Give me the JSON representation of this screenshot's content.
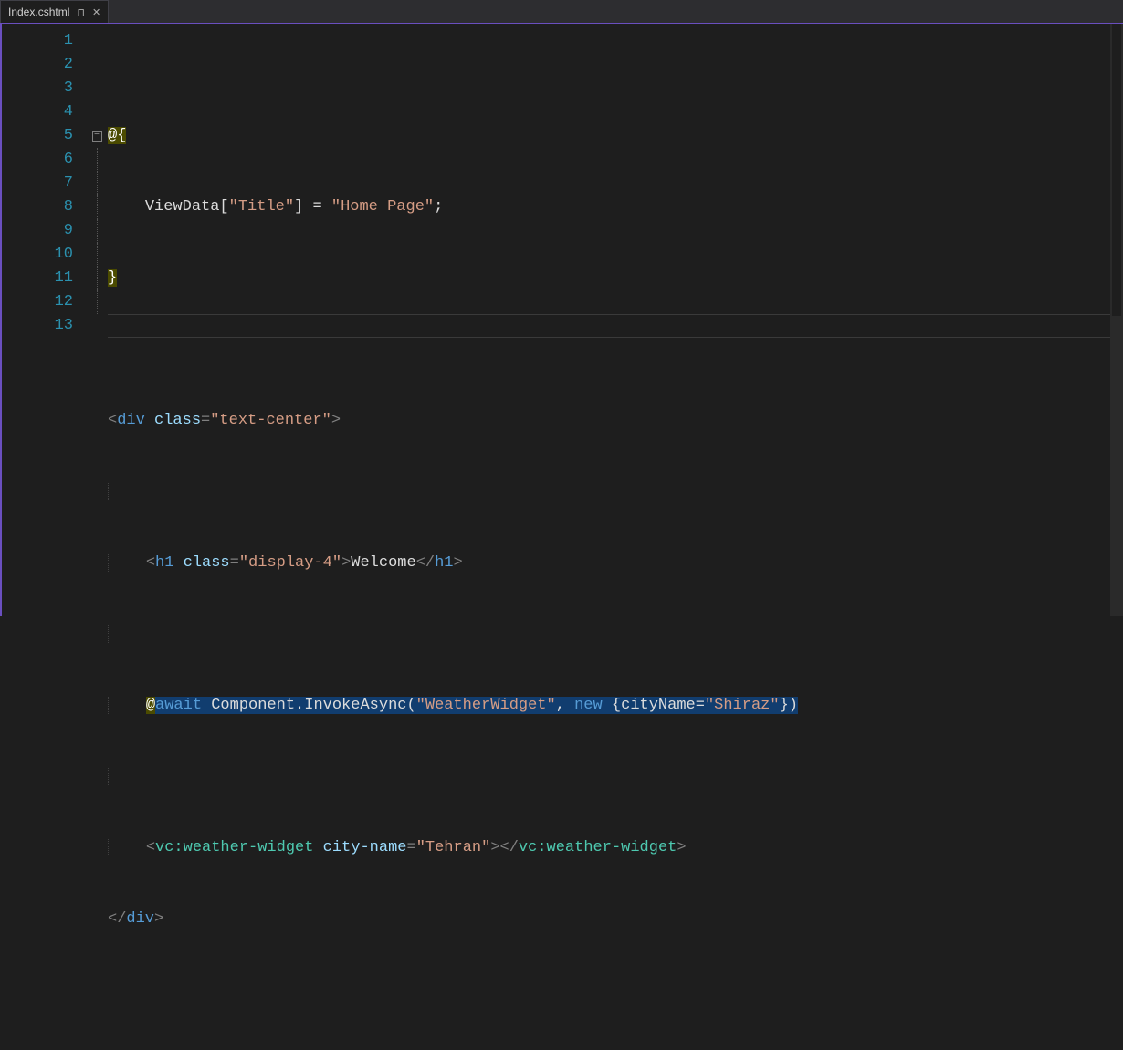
{
  "tab": {
    "title": "Index.cshtml"
  },
  "lineNumbers": [
    "1",
    "2",
    "3",
    "4",
    "5",
    "6",
    "7",
    "8",
    "9",
    "10",
    "11",
    "12",
    "13"
  ],
  "tokens": {
    "l1": {
      "at": "@",
      "brace": "{"
    },
    "l2": {
      "vd": "ViewData[",
      "q1": "\"Title\"",
      "br": "]",
      "eq": " = ",
      "q2": "\"Home Page\"",
      "semi": ";"
    },
    "l3": {
      "brace": "}"
    },
    "l5": {
      "lt": "<",
      "tag": "div",
      "sp": " ",
      "attr": "class",
      "eq": "=",
      "val": "\"text-center\"",
      "gt": ">"
    },
    "l7": {
      "lt": "<",
      "tag": "h1",
      "sp": " ",
      "attr": "class",
      "eq": "=",
      "val": "\"display-4\"",
      "gt": ">",
      "txt": "Welcome",
      "lt2": "</",
      "tag2": "h1",
      "gt2": ">"
    },
    "l9": {
      "at": "@",
      "await": "await",
      "sp": " ",
      "comp": "Component.InvokeAsync(",
      "str1": "\"WeatherWidget\"",
      "comma": ", ",
      "new": "new",
      "sp2": " ",
      "obj1": "{cityName=",
      "str2": "\"Shiraz\"",
      "obj2": "})"
    },
    "l11": {
      "lt": "<",
      "tag": "vc:weather-widget",
      "sp": " ",
      "attr": "city-name",
      "eq": "=",
      "val": "\"Tehran\"",
      "gt": ">",
      "lt2": "</",
      "tag2": "vc:weather-widget",
      "gt2": ">"
    },
    "l12": {
      "lt": "</",
      "tag": "div",
      "gt": ">"
    }
  }
}
